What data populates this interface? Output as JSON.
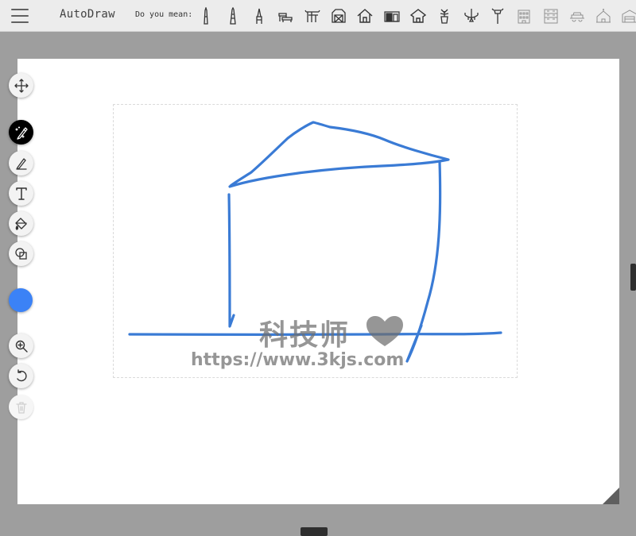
{
  "app": {
    "title": "AutoDraw",
    "suggestions_label": "Do you mean:"
  },
  "suggestions": [
    {
      "icon": "tower-icon"
    },
    {
      "icon": "obelisk-icon"
    },
    {
      "icon": "spire-icon"
    },
    {
      "icon": "bench-icon"
    },
    {
      "icon": "pergola-icon"
    },
    {
      "icon": "barn-icon"
    },
    {
      "icon": "house-icon"
    },
    {
      "icon": "shed-icon"
    },
    {
      "icon": "cottage-icon"
    },
    {
      "icon": "potted-plant-icon"
    },
    {
      "icon": "chandelier-icon"
    },
    {
      "icon": "sign-post-icon"
    },
    {
      "icon": "building-icon"
    },
    {
      "icon": "apartment-icon"
    },
    {
      "icon": "cart-icon"
    },
    {
      "icon": "church-icon"
    },
    {
      "icon": "warehouse-icon"
    }
  ],
  "tools": [
    {
      "name": "move",
      "icon": "move-icon",
      "state": "normal"
    },
    {
      "name": "autodraw",
      "icon": "autodraw-icon",
      "state": "active"
    },
    {
      "name": "draw",
      "icon": "pencil-icon",
      "state": "normal"
    },
    {
      "name": "type",
      "icon": "text-icon",
      "state": "normal"
    },
    {
      "name": "fill",
      "icon": "fill-bucket-icon",
      "state": "normal"
    },
    {
      "name": "shape",
      "icon": "shapes-icon",
      "state": "normal"
    },
    {
      "name": "zoom",
      "icon": "zoom-icon",
      "state": "normal"
    },
    {
      "name": "undo",
      "icon": "undo-icon",
      "state": "normal"
    },
    {
      "name": "delete",
      "icon": "trash-icon",
      "state": "disabled"
    }
  ],
  "colors": {
    "stroke": "#3a7bd5",
    "selected_color": "#3b82f6",
    "topbar_bg": "#ececec",
    "canvas_bg": "#ffffff",
    "frame_bg": "#9e9e9e"
  },
  "watermark": {
    "title": "科技师",
    "url": "https://www.3kjs.com"
  }
}
